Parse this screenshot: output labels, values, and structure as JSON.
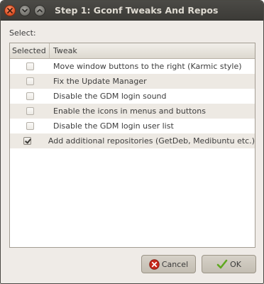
{
  "window": {
    "title": "Step 1: Gconf Tweaks And Repos",
    "controls": [
      "close-icon",
      "minimize-icon",
      "maximize-icon"
    ]
  },
  "select_label": "Select:",
  "table": {
    "columns": [
      "Selected",
      "Tweak"
    ],
    "rows": [
      {
        "checked": false,
        "tweak": "Move window buttons to the right (Karmic style)"
      },
      {
        "checked": false,
        "tweak": "Fix the Update Manager"
      },
      {
        "checked": false,
        "tweak": "Disable the GDM login sound"
      },
      {
        "checked": false,
        "tweak": "Enable the icons in menus and buttons"
      },
      {
        "checked": false,
        "tweak": "Disable the GDM login user list"
      },
      {
        "checked": true,
        "tweak": "Add additional repositories (GetDeb, Medibuntu etc.)"
      }
    ]
  },
  "buttons": {
    "cancel": "Cancel",
    "ok": "OK"
  },
  "colors": {
    "titlebar": "#3c3b37",
    "close_button": "#e2572c",
    "window_bg": "#efebe7",
    "ok_check": "#5fa820",
    "cancel_icon": "#c7281a"
  }
}
